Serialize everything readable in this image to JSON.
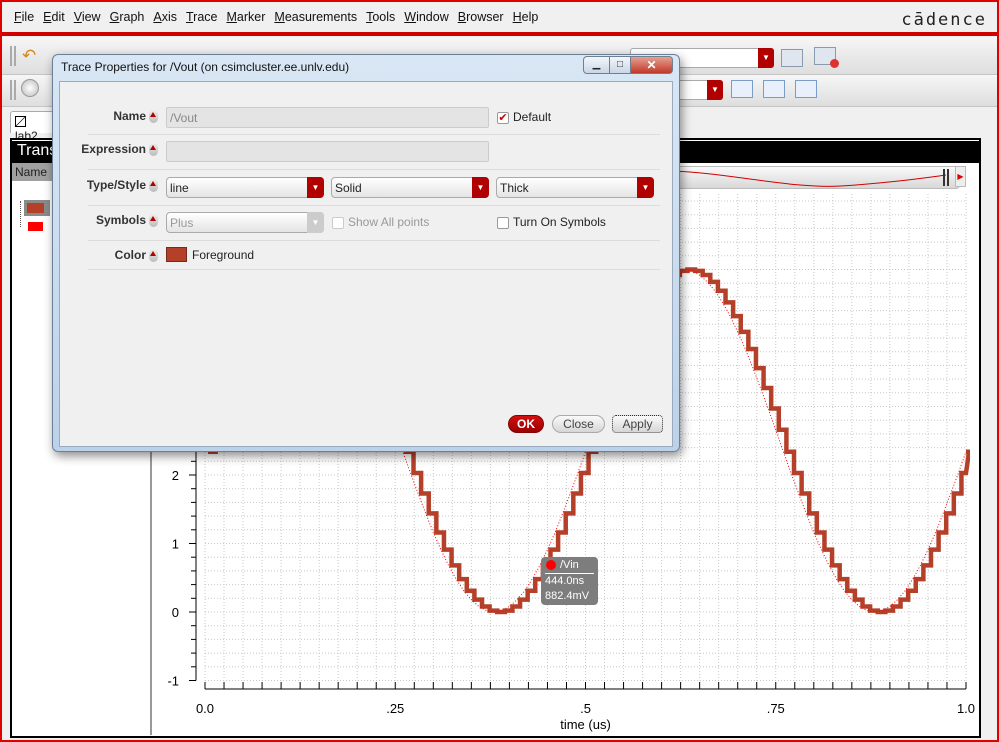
{
  "menubar": {
    "items": [
      "File",
      "Edit",
      "View",
      "Graph",
      "Axis",
      "Trace",
      "Marker",
      "Measurements",
      "Tools",
      "Window",
      "Browser",
      "Help"
    ],
    "logo": "cādence"
  },
  "toolbar": {
    "icons": [
      "undo-icon",
      "refresh-icon",
      "save-window-icon",
      "hide-icon",
      "move-trace-up-down-icon",
      "refresh-plot-icon",
      "zoom-fit-icon"
    ]
  },
  "tab": {
    "label": "lab2"
  },
  "window": {
    "header": "Trans",
    "name_column": "Name"
  },
  "legend": {
    "items": [
      {
        "color": "#b5402a",
        "selected": true
      },
      {
        "color": "#ff0000",
        "selected": false
      }
    ]
  },
  "dialog": {
    "title": "Trace Properties for /Vout (on csimcluster.ee.unlv.edu)",
    "name_label": "Name",
    "name_value": "/Vout",
    "default_label": "Default",
    "default_checked": true,
    "expression_label": "Expression",
    "expression_value": "",
    "type_style_label": "Type/Style",
    "type_value": "line",
    "style_value": "Solid",
    "thickness_value": "Thick",
    "symbols_label": "Symbols",
    "symbols_value": "Plus",
    "show_all_points_label": "Show All points",
    "turn_on_symbols_label": "Turn On Symbols",
    "color_label": "Color",
    "color_value": "Foreground",
    "color_swatch": "#b5402a",
    "ok_label": "OK",
    "close_label": "Close",
    "apply_label": "Apply"
  },
  "marker": {
    "trace": "/Vin",
    "x": "444.0ns",
    "y": "882.4mV"
  },
  "chart_data": {
    "type": "line",
    "xlabel": "time (us)",
    "xlim": [
      0,
      1.0
    ],
    "ylim": [
      -1,
      6
    ],
    "x_ticks": [
      "0.0",
      ".25",
      ".5",
      ".75",
      "1.0"
    ],
    "y_ticks": [
      "-1",
      "0",
      "1",
      "2"
    ],
    "grid": true,
    "x_step": 0.01,
    "series": [
      {
        "name": "/Vout",
        "color": "#b5402a",
        "style": "step-thick",
        "values": [
          2.34,
          2.66,
          2.97,
          3.27,
          3.56,
          3.84,
          4.09,
          4.32,
          4.52,
          4.69,
          4.82,
          4.92,
          4.98,
          5.0,
          4.98,
          4.92,
          4.82,
          4.69,
          4.52,
          4.32,
          4.09,
          3.84,
          3.56,
          3.27,
          2.97,
          2.66,
          2.34,
          2.03,
          1.73,
          1.44,
          1.16,
          0.91,
          0.68,
          0.48,
          0.31,
          0.18,
          0.08,
          0.02,
          0.0,
          0.02,
          0.08,
          0.18,
          0.31,
          0.48,
          0.68,
          0.91,
          1.16,
          1.44,
          1.73,
          2.03,
          2.34,
          2.66,
          2.97,
          3.27,
          3.56,
          3.84,
          4.09,
          4.32,
          4.52,
          4.69,
          4.82,
          4.92,
          4.98,
          5.0,
          4.98,
          4.92,
          4.82,
          4.69,
          4.52,
          4.32,
          4.09,
          3.84,
          3.56,
          3.27,
          2.97,
          2.66,
          2.34,
          2.03,
          1.73,
          1.44,
          1.16,
          0.91,
          0.68,
          0.48,
          0.31,
          0.18,
          0.08,
          0.02,
          0.0,
          0.02,
          0.08,
          0.18,
          0.31,
          0.48,
          0.68,
          0.91,
          1.16,
          1.44,
          1.73,
          2.03,
          2.34
        ]
      },
      {
        "name": "/Vin",
        "color": "#ff0000",
        "style": "dotted-thin",
        "values": [
          2.34,
          2.66,
          2.97,
          3.27,
          3.56,
          3.84,
          4.09,
          4.32,
          4.52,
          4.69,
          4.82,
          4.92,
          4.98,
          5.0,
          4.98,
          4.92,
          4.82,
          4.69,
          4.52,
          4.32,
          4.09,
          3.84,
          3.56,
          3.27,
          2.97,
          2.66,
          2.34,
          2.03,
          1.73,
          1.44,
          1.16,
          0.91,
          0.68,
          0.48,
          0.31,
          0.18,
          0.08,
          0.02,
          0.0,
          0.02,
          0.08,
          0.18,
          0.31,
          0.48,
          0.68,
          0.91,
          1.16,
          1.44,
          1.73,
          2.03,
          2.34,
          2.66,
          2.97,
          3.27,
          3.56,
          3.84,
          4.09,
          4.32,
          4.52,
          4.69,
          4.82,
          4.92,
          4.98,
          5.0,
          4.98,
          4.92,
          4.82,
          4.69,
          4.52,
          4.32,
          4.09,
          3.84,
          3.56,
          3.27,
          2.97,
          2.66,
          2.34,
          2.03,
          1.73,
          1.44,
          1.16,
          0.91,
          0.68,
          0.48,
          0.31,
          0.18,
          0.08,
          0.02,
          0.0,
          0.02,
          0.08,
          0.18,
          0.31,
          0.48,
          0.68,
          0.91,
          1.16,
          1.44,
          1.73,
          2.03,
          2.34
        ]
      }
    ]
  }
}
